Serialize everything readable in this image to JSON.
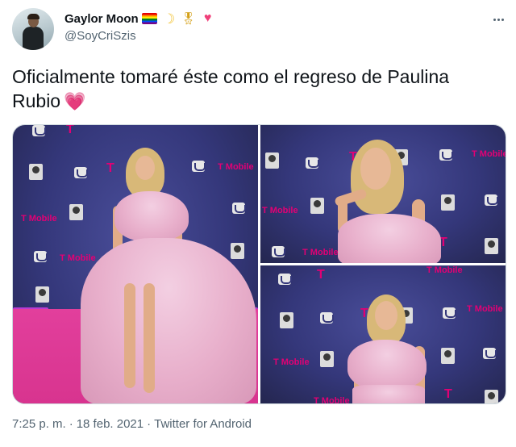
{
  "author": {
    "display_name": "Gaylor Moon",
    "handle": "@SoyCriSzis",
    "name_emojis": [
      "rainbow-flag",
      "crescent-moon",
      "military-medal",
      "red-heart"
    ]
  },
  "tweet": {
    "text": "Oficialmente tomaré éste como el regreso de Paulina Rubio",
    "text_emoji": "sparkling-heart"
  },
  "media": {
    "photo_count": 3,
    "backdrop_logos": {
      "tmobile": "T Mobile",
      "t": "T"
    }
  },
  "meta": {
    "time": "7:25 p. m.",
    "separator": "·",
    "date": "18 feb. 2021",
    "source": "Twitter for Android"
  },
  "colors": {
    "text_primary": "#0f1419",
    "text_secondary": "#536471",
    "tmobile_magenta": "#e20074",
    "backdrop_purple": "#34377a",
    "carpet_pink": "#e23f9c",
    "dress_pink": "#e8afcb"
  }
}
